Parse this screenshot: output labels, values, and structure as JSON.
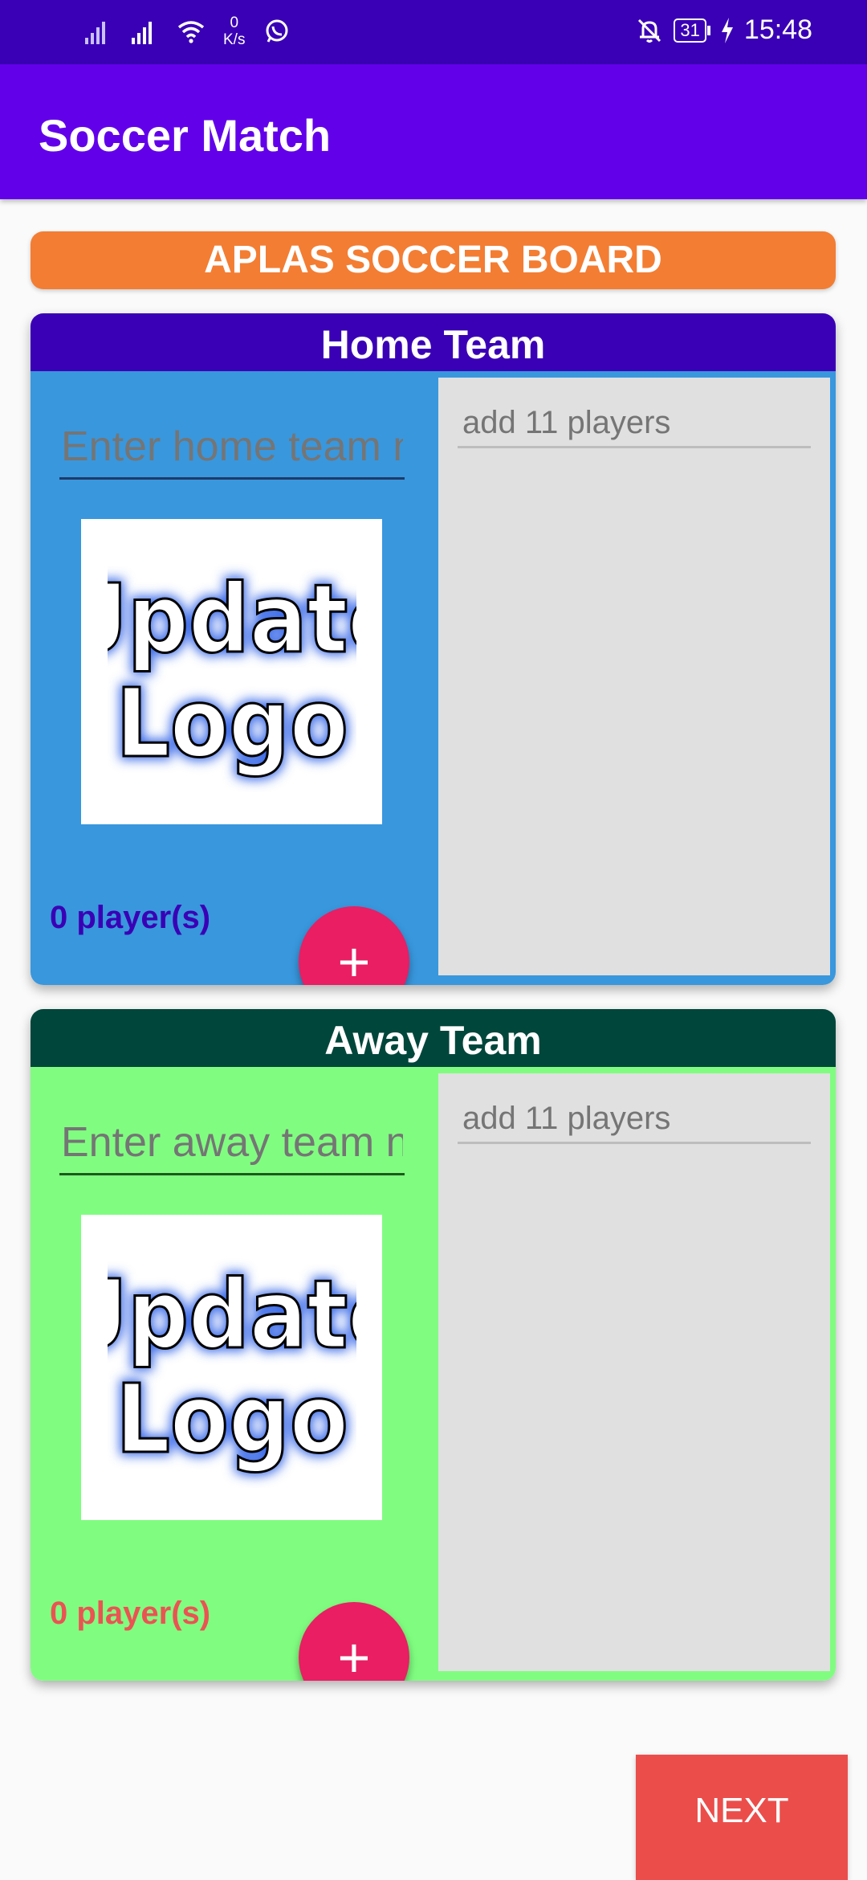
{
  "status_bar": {
    "net_speed_value": "0",
    "net_speed_unit": "K/s",
    "battery": "31",
    "time": "15:48",
    "icons": [
      "signal-icon",
      "signal-icon",
      "wifi-icon",
      "whatsapp-icon",
      "bell-off-icon",
      "battery-icon",
      "charging-icon"
    ]
  },
  "app_bar": {
    "title": "Soccer Match"
  },
  "banner": {
    "text": "APLAS SOCCER BOARD"
  },
  "home": {
    "header": "Home Team",
    "name_placeholder": "Enter home team name",
    "logo_line1": "Update",
    "logo_line2": "Logo",
    "add_button": "+",
    "player_count": "0 player(s)",
    "players_placeholder": "add 11 players",
    "colors": {
      "header": "#3a00b5",
      "body": "#3997dd",
      "count": "#3a00b5"
    }
  },
  "away": {
    "header": "Away Team",
    "name_placeholder": "Enter away team name",
    "logo_line1": "Update",
    "logo_line2": "Logo",
    "add_button": "+",
    "player_count": "0 player(s)",
    "players_placeholder": "add 11 players",
    "colors": {
      "header": "#00463b",
      "body": "#80fd80",
      "count": "#eb5353"
    }
  },
  "footer": {
    "next_label": "NEXT"
  },
  "colors": {
    "status_bar": "#3a00b5",
    "app_bar": "#6200ea",
    "banner": "#f37d33",
    "fab": "#e91e63",
    "next": "#eb4d4b"
  }
}
